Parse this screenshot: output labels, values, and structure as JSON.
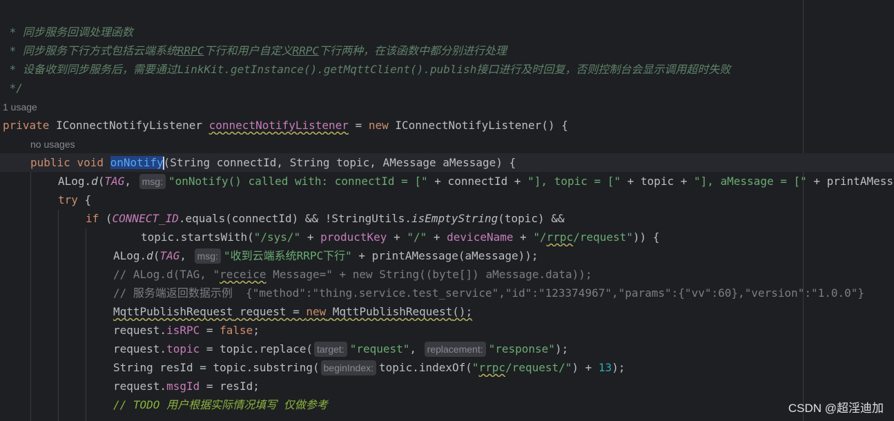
{
  "doc_comment": {
    "open": "/**",
    "line1_prefix": " * ",
    "line1": "同步服务回调处理函数",
    "line2_prefix": " * ",
    "line2_a": "同步服务下行方式包括云端系统",
    "line2_b": "RRPC",
    "line2_c": "下行和用户自定义",
    "line2_d": "RRPC",
    "line2_e": "下行两种，在该函数中都分别进行处理",
    "line3_prefix": " * ",
    "line3_a": "设备收到同步服务后，需要通过",
    "line3_b": "LinkKit.getInstance().getMqttClient().publish",
    "line3_c": "接口进行及时回复，否则控制台会显示调用超时失败",
    "close": " */"
  },
  "lens": {
    "usage": "1 usage",
    "no_usages": "no usages"
  },
  "hints": {
    "msg": "msg:",
    "target": "target:",
    "replacement": "replacement:",
    "begin_index": "beginIndex:"
  },
  "code": {
    "kw_private": "private",
    "kw_public": "public",
    "kw_void": "void",
    "kw_new": "new",
    "kw_try": "try",
    "kw_if": "if",
    "kw_false": "false",
    "listener_type": "IConnectNotifyListener",
    "listener_field": "connectNotifyListener",
    "assign": " = ",
    "new_listener_tail": "() {",
    "onnotify_name": "onNotify",
    "onnotify_params": "(String connectId, String topic, AMessage aMessage) {",
    "alog": "ALog.",
    "alog_d": "d",
    "tag": "TAG",
    "tag_sep": ", ",
    "log1_str1": "\"onNotify() called with: connectId = [\"",
    "log1_mid1": " + connectId + ",
    "log1_str2": "\"], topic = [\"",
    "log1_mid2": " + topic + ",
    "log1_str3": "\"], aMessage = [\"",
    "log1_tail": " + printAMessage",
    "try_brace": " {",
    "if_open": " (",
    "connect_id": "CONNECT_ID",
    "if_rest1": ".equals(connectId) && !StringUtils.",
    "is_empty": "isEmptyString",
    "if_rest2": "(topic) &&",
    "topic_starts": "topic.startsWith(",
    "str_sys": "\"/sys/\"",
    "plus": " + ",
    "product_key": "productKey",
    "str_slash": "\"/\"",
    "device_name": "deviceName",
    "str_rrpc_a": "\"/",
    "str_rrpc_b": "rrpc",
    "str_rrpc_c": "/request\"",
    "starts_tail": ")) {",
    "log2_str": "\"收到云端系统RRPC下行\"",
    "log2_tail": " + printAMessage(aMessage));",
    "comment1_a": "// ALog.d(TAG, \"",
    "comment1_b": "receice",
    "comment1_c": " Message=\" + new String((byte[]) aMessage.data));",
    "comment2": "// 服务端返回数据示例  {\"method\":\"thing.service.test_service\",\"id\":\"123374967\",\"params\":{\"vv\":60},\"version\":\"1.0.0\"}",
    "req_type": "MqttPublishRequest",
    "req_decl": " request = ",
    "req_new_tail": "();",
    "req_dot": "request.",
    "is_rpc": "isRPC",
    "eq": " = ",
    "semi": ";",
    "topic_field": "topic",
    "replace_call": " = topic.replace(",
    "str_request": "\"request\"",
    "comma": ", ",
    "str_response": "\"response\"",
    "call_end": ");",
    "resid_decl": "String resId = topic.substring(",
    "index_of": "topic.indexOf(",
    "str_rrpc2_a": "\"",
    "str_rrpc2_b": "rrpc",
    "str_rrpc2_c": "/request/\"",
    "close_paren_plus": ") + ",
    "num13": "13",
    "msg_id": "msgId",
    "msg_id_val": " = resId;",
    "todo_prefix": "// ",
    "todo_word": "TODO",
    "todo_text": " 用户根据实际情况填写 仅做参考"
  },
  "watermark": "CSDN @超淫迪加"
}
